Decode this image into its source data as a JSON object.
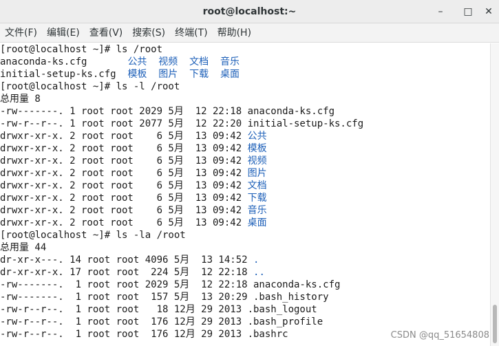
{
  "window": {
    "title": "root@localhost:~",
    "minimize_glyph": "–",
    "maximize_glyph": "□",
    "close_glyph": "✕"
  },
  "menu": [
    {
      "name": "file",
      "label": "文件(F)"
    },
    {
      "name": "edit",
      "label": "编辑(E)"
    },
    {
      "name": "view",
      "label": "查看(V)"
    },
    {
      "name": "search",
      "label": "搜索(S)"
    },
    {
      "name": "terminal",
      "label": "终端(T)"
    },
    {
      "name": "help",
      "label": "帮助(H)"
    }
  ],
  "colors": {
    "dir_blue": "#1c5fb8",
    "text": "#1a1a1a"
  },
  "terminal_lines": [
    [
      {
        "t": "[root@localhost ~]# ls /root"
      }
    ],
    [
      {
        "t": "anaconda-ks.cfg       "
      },
      {
        "t": "公共  视频  文档  音乐",
        "c": "blue"
      }
    ],
    [
      {
        "t": "initial-setup-ks.cfg  "
      },
      {
        "t": "模板  图片  下载  桌面",
        "c": "blue"
      }
    ],
    [
      {
        "t": "[root@localhost ~]# ls -l /root"
      }
    ],
    [
      {
        "t": "总用量 8"
      }
    ],
    [
      {
        "t": "-rw-------. 1 root root 2029 5月  12 22:18 anaconda-ks.cfg"
      }
    ],
    [
      {
        "t": "-rw-r--r--. 1 root root 2077 5月  12 22:20 initial-setup-ks.cfg"
      }
    ],
    [
      {
        "t": "drwxr-xr-x. 2 root root    6 5月  13 09:42 "
      },
      {
        "t": "公共",
        "c": "blue"
      }
    ],
    [
      {
        "t": "drwxr-xr-x. 2 root root    6 5月  13 09:42 "
      },
      {
        "t": "模板",
        "c": "blue"
      }
    ],
    [
      {
        "t": "drwxr-xr-x. 2 root root    6 5月  13 09:42 "
      },
      {
        "t": "视频",
        "c": "blue"
      }
    ],
    [
      {
        "t": "drwxr-xr-x. 2 root root    6 5月  13 09:42 "
      },
      {
        "t": "图片",
        "c": "blue"
      }
    ],
    [
      {
        "t": "drwxr-xr-x. 2 root root    6 5月  13 09:42 "
      },
      {
        "t": "文档",
        "c": "blue"
      }
    ],
    [
      {
        "t": "drwxr-xr-x. 2 root root    6 5月  13 09:42 "
      },
      {
        "t": "下载",
        "c": "blue"
      }
    ],
    [
      {
        "t": "drwxr-xr-x. 2 root root    6 5月  13 09:42 "
      },
      {
        "t": "音乐",
        "c": "blue"
      }
    ],
    [
      {
        "t": "drwxr-xr-x. 2 root root    6 5月  13 09:42 "
      },
      {
        "t": "桌面",
        "c": "blue"
      }
    ],
    [
      {
        "t": "[root@localhost ~]# ls -la /root"
      }
    ],
    [
      {
        "t": "总用量 44"
      }
    ],
    [
      {
        "t": "dr-xr-x---. 14 root root 4096 5月  13 14:52 "
      },
      {
        "t": ".",
        "c": "blue"
      }
    ],
    [
      {
        "t": "dr-xr-xr-x. 17 root root  224 5月  12 22:18 "
      },
      {
        "t": "..",
        "c": "blue"
      }
    ],
    [
      {
        "t": "-rw-------.  1 root root 2029 5月  12 22:18 anaconda-ks.cfg"
      }
    ],
    [
      {
        "t": "-rw-------.  1 root root  157 5月  13 20:29 .bash_history"
      }
    ],
    [
      {
        "t": "-rw-r--r--.  1 root root   18 12月 29 2013 .bash_logout"
      }
    ],
    [
      {
        "t": "-rw-r--r--.  1 root root  176 12月 29 2013 .bash_profile"
      }
    ],
    [
      {
        "t": "-rw-r--r--.  1 root root  176 12月 29 2013 .bashrc"
      }
    ]
  ],
  "watermark": "CSDN @qq_51654808"
}
